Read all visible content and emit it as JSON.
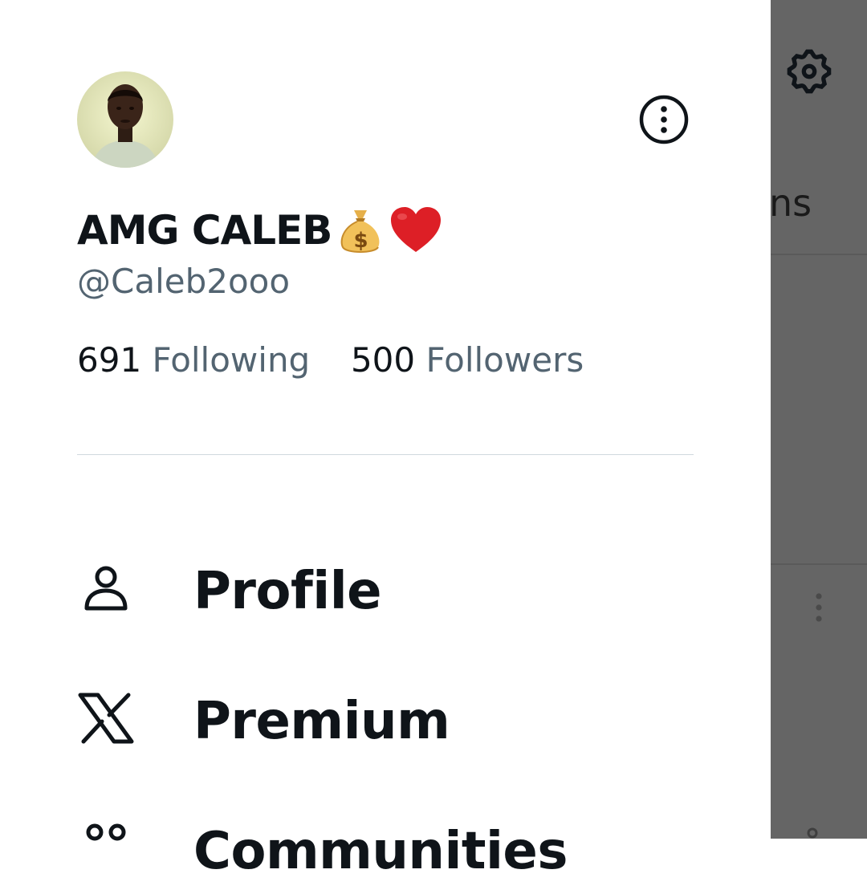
{
  "background_app": {
    "tab_fragment": "ns",
    "icons": [
      "gear-icon",
      "more-vertical-icon",
      "person-icon"
    ]
  },
  "drawer": {
    "profile": {
      "display_name": "AMG CALEB",
      "name_emojis": [
        "money-bag-emoji",
        "red-heart-emoji"
      ],
      "handle": "@Caleb2ooo",
      "following_count": "691",
      "following_label": "Following",
      "followers_count": "500",
      "followers_label": "Followers"
    },
    "more_icon": "more-circle-icon",
    "menu": [
      {
        "label": "Profile",
        "icon": "person-icon"
      },
      {
        "label": "Premium",
        "icon": "x-logo-icon"
      },
      {
        "label": "Communities",
        "icon": "communities-icon"
      }
    ]
  },
  "colors": {
    "text_primary": "#0f1419",
    "text_secondary": "#536471",
    "divider": "#cfd9de",
    "scrim": "#656565"
  }
}
